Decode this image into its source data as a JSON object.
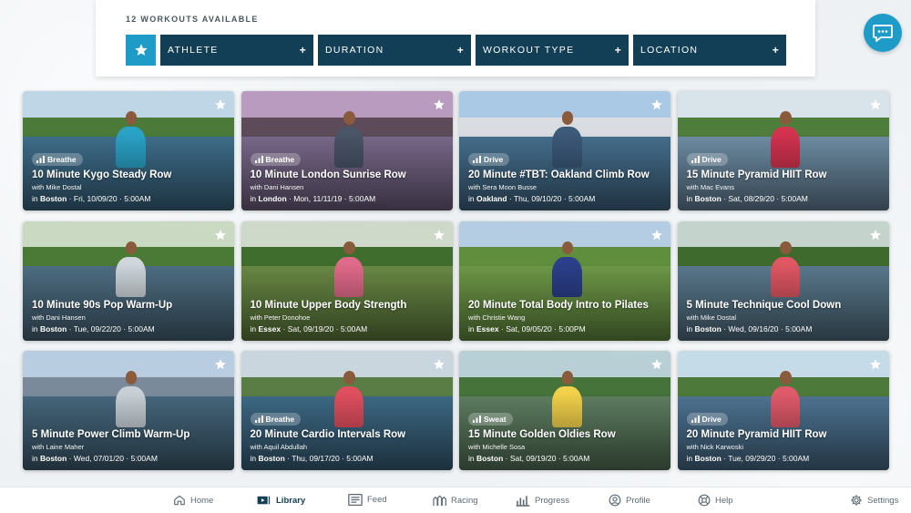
{
  "filters": {
    "count_label": "12 WORKOUTS AVAILABLE",
    "buttons": [
      {
        "label": "ATHLETE",
        "icon": "plus-icon"
      },
      {
        "label": "DURATION",
        "icon": "plus-icon"
      },
      {
        "label": "WORKOUT TYPE",
        "icon": "plus-icon"
      },
      {
        "label": "LOCATION",
        "icon": "plus-icon"
      }
    ],
    "favorites_icon": "star-icon"
  },
  "chat": {
    "icon": "chat-bubble-icon",
    "color": "#1e9bc6"
  },
  "workouts": [
    {
      "badge": "Breathe",
      "title": "10 Minute Kygo Steady Row",
      "athlete": "with Mike Dostal",
      "location": "Boston",
      "date": "Fri, 10/09/20",
      "time": "5:00AM"
    },
    {
      "badge": "Breathe",
      "title": "10 Minute London Sunrise Row",
      "athlete": "with Dani Hansen",
      "location": "London",
      "date": "Mon, 11/11/19",
      "time": "5:00AM"
    },
    {
      "badge": "Drive",
      "title": "20 Minute #TBT: Oakland Climb Row",
      "athlete": "with Sera Moon Busse",
      "location": "Oakland",
      "date": "Thu, 09/10/20",
      "time": "5:00AM"
    },
    {
      "badge": "Drive",
      "title": "15 Minute Pyramid HIIT Row",
      "athlete": "with Mac Evans",
      "location": "Boston",
      "date": "Sat, 08/29/20",
      "time": "5:00AM"
    },
    {
      "badge": "",
      "title": "10 Minute 90s Pop Warm-Up",
      "athlete": "with Dani Hansen",
      "location": "Boston",
      "date": "Tue, 09/22/20",
      "time": "5:00AM"
    },
    {
      "badge": "",
      "title": "10 Minute Upper Body Strength",
      "athlete": "with Peter Donohoe",
      "location": "Essex",
      "date": "Sat, 09/19/20",
      "time": "5:00AM"
    },
    {
      "badge": "",
      "title": "20 Minute Total Body Intro to Pilates",
      "athlete": "with Christie Wang",
      "location": "Essex",
      "date": "Sat, 09/05/20",
      "time": "5:00PM"
    },
    {
      "badge": "",
      "title": "5 Minute Technique Cool Down",
      "athlete": "with Mike Dostal",
      "location": "Boston",
      "date": "Wed, 09/16/20",
      "time": "5:00AM"
    },
    {
      "badge": "",
      "title": "5 Minute Power Climb Warm-Up",
      "athlete": "with Laine Maher",
      "location": "Boston",
      "date": "Wed, 07/01/20",
      "time": "5:00AM"
    },
    {
      "badge": "Breathe",
      "title": "20 Minute Cardio Intervals Row",
      "athlete": "with Aquil Abdullah",
      "location": "Boston",
      "date": "Thu, 09/17/20",
      "time": "5:00AM"
    },
    {
      "badge": "Sweat",
      "title": "15 Minute Golden Oldies Row",
      "athlete": "with Michelle Sosa",
      "location": "Boston",
      "date": "Sat, 09/19/20",
      "time": "5:00AM"
    },
    {
      "badge": "Drive",
      "title": "20 Minute Pyramid HIIT Row",
      "athlete": "with Nick Karwoski",
      "location": "Boston",
      "date": "Tue, 09/29/20",
      "time": "5:00AM"
    }
  ],
  "card_meta_prefix": "in",
  "card_meta_sep": "·",
  "nav": {
    "items": [
      {
        "label": "Home",
        "icon": "home-icon"
      },
      {
        "label": "Library",
        "icon": "library-icon",
        "active": true
      },
      {
        "label": "Feed",
        "icon": "feed-icon"
      },
      {
        "label": "Racing",
        "icon": "racing-icon"
      },
      {
        "label": "Progress",
        "icon": "progress-icon"
      },
      {
        "label": "Profile",
        "icon": "profile-icon"
      },
      {
        "label": "Help",
        "icon": "help-icon"
      },
      {
        "label": "Settings",
        "icon": "settings-icon"
      }
    ]
  },
  "colors": {
    "accent": "#1e9bc6",
    "filter_bg": "#123e56",
    "active_nav": "#123e56"
  }
}
